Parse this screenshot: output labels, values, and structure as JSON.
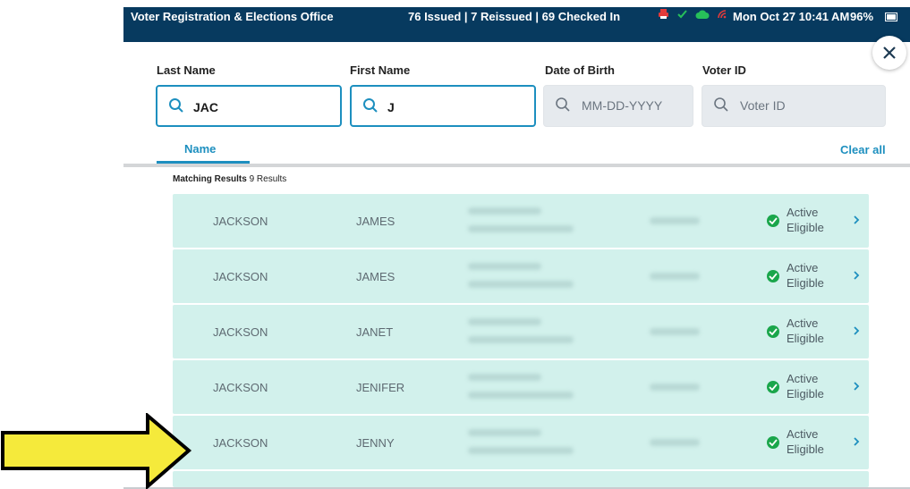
{
  "statusbar": {
    "title": "Voter Registration & Elections Office",
    "counts": "76 Issued | 7 Reissued | 69 Checked In",
    "datetime": "Mon Oct 27  10:41 AM",
    "battery": "96%",
    "icons": [
      "printer-icon",
      "check-icon",
      "cloud-icon",
      "signal-icon"
    ],
    "bg_color": "#073a5f"
  },
  "search": {
    "last_name_label": "Last Name",
    "first_name_label": "First Name",
    "dob_label": "Date of Birth",
    "voter_id_label": "Voter ID",
    "last_name_value": "JAC",
    "first_name_value": "J",
    "dob_placeholder": "MM-DD-YYYY",
    "voter_id_placeholder": "Voter ID"
  },
  "tabs": {
    "name_label": "Name",
    "clear_all": "Clear all"
  },
  "results": {
    "heading": "Matching Results",
    "count_text": "9 Results",
    "rows": [
      {
        "last": "JACKSON",
        "first": "JAMES",
        "status1": "Active",
        "status2": "Eligible"
      },
      {
        "last": "JACKSON",
        "first": "JAMES",
        "status1": "Active",
        "status2": "Eligible"
      },
      {
        "last": "JACKSON",
        "first": "JANET",
        "status1": "Active",
        "status2": "Eligible"
      },
      {
        "last": "JACKSON",
        "first": "JENIFER",
        "status1": "Active",
        "status2": "Eligible"
      },
      {
        "last": "JACKSON",
        "first": "JENNY",
        "status1": "Active",
        "status2": "Eligible"
      }
    ]
  },
  "colors": {
    "accent": "#1d8fbf",
    "row_bg": "#d2f1ec",
    "status_green": "#1aa64b",
    "arrow_fill": "#f5ea3b"
  }
}
